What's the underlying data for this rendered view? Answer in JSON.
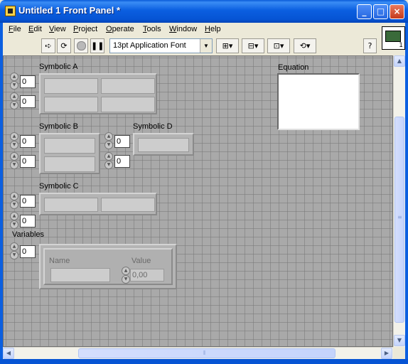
{
  "window": {
    "title": "Untitled 1 Front Panel *",
    "minimize": "_",
    "maximize": "□",
    "close": "×"
  },
  "menu": [
    {
      "first": "F",
      "rest": "ile"
    },
    {
      "first": "E",
      "rest": "dit"
    },
    {
      "first": "V",
      "rest": "iew"
    },
    {
      "first": "P",
      "rest": "roject"
    },
    {
      "first": "O",
      "rest": "perate"
    },
    {
      "first": "T",
      "rest": "ools"
    },
    {
      "first": "W",
      "rest": "indow"
    },
    {
      "first": "H",
      "rest": "elp"
    }
  ],
  "toolbar": {
    "font": "13pt Application Font",
    "help": "?",
    "vi_icon_number": "1",
    "icons": [
      "run-arrow-icon",
      "run-continuously-icon",
      "abort-icon",
      "pause-icon",
      "align-icon",
      "distribute-icon",
      "resize-icon",
      "reorder-icon"
    ]
  },
  "panel": {
    "symbolic_a": {
      "label": "Symbolic A",
      "index_1": "0",
      "index_2": "0"
    },
    "symbolic_b": {
      "label": "Symbolic B",
      "index_1": "0",
      "index_2": "0"
    },
    "symbolic_c": {
      "label": "Symbolic C",
      "index_1": "0",
      "index_2": "0"
    },
    "symbolic_d": {
      "label": "Symbolic D",
      "index_1": "0",
      "index_2": "0"
    },
    "variables": {
      "label": "Variables",
      "index": "0",
      "name_label": "Name",
      "value_label": "Value",
      "value": "0,00"
    },
    "equation": {
      "label": "Equation"
    }
  },
  "colors": {
    "titlebar": "#0b5fe0",
    "panel_bg": "#a9a9a9",
    "chrome": "#ece9d8"
  }
}
